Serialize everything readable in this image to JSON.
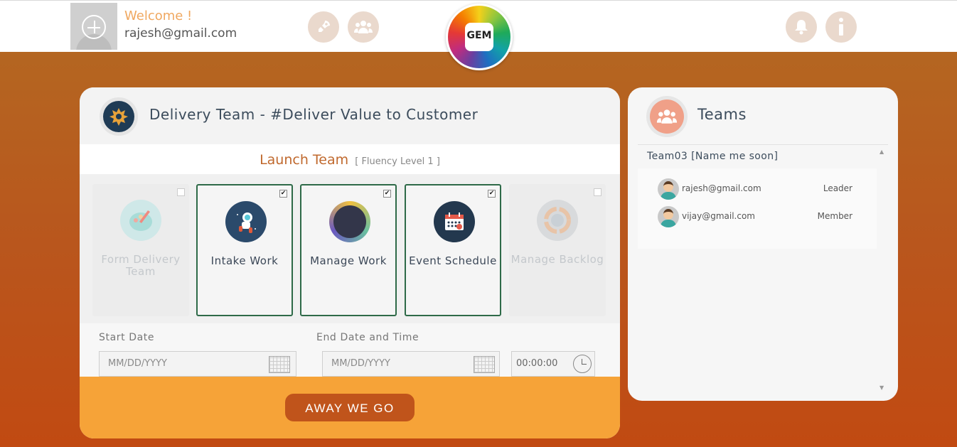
{
  "header": {
    "welcome": "Welcome !",
    "user_email": "rajesh@gmail.com",
    "logo_text": "GEM",
    "icons": [
      "rocket-icon",
      "team-icon",
      "bell-icon",
      "info-icon"
    ]
  },
  "main": {
    "title": "Delivery Team - #Deliver Value to Customer",
    "launch_title": "Launch Team",
    "fluency": "[ Fluency Level 1 ]",
    "tiles": [
      {
        "label": "Form Delivery Team",
        "checked": false,
        "enabled": false
      },
      {
        "label": "Intake Work",
        "checked": true,
        "enabled": true
      },
      {
        "label": "Manage Work",
        "checked": true,
        "enabled": true
      },
      {
        "label": "Event Schedule",
        "checked": true,
        "enabled": true
      },
      {
        "label": "Manage Backlog",
        "checked": false,
        "enabled": false
      }
    ],
    "start_date_label": "Start Date",
    "start_date_placeholder": "MM/DD/YYYY",
    "end_date_label": "End Date and Time",
    "end_date_placeholder": "MM/DD/YYYY",
    "end_time_value": "00:00:00",
    "go_button": "AWAY WE GO"
  },
  "teams_panel": {
    "title": "Teams",
    "team_name": "Team03 [Name me soon]",
    "members": [
      {
        "email": "rajesh@gmail.com",
        "role": "Leader"
      },
      {
        "email": "vijay@gmail.com",
        "role": "Member"
      }
    ]
  },
  "colors": {
    "accent": "#c0541b",
    "footer": "#f6a338",
    "active_border": "#2e6a48"
  }
}
